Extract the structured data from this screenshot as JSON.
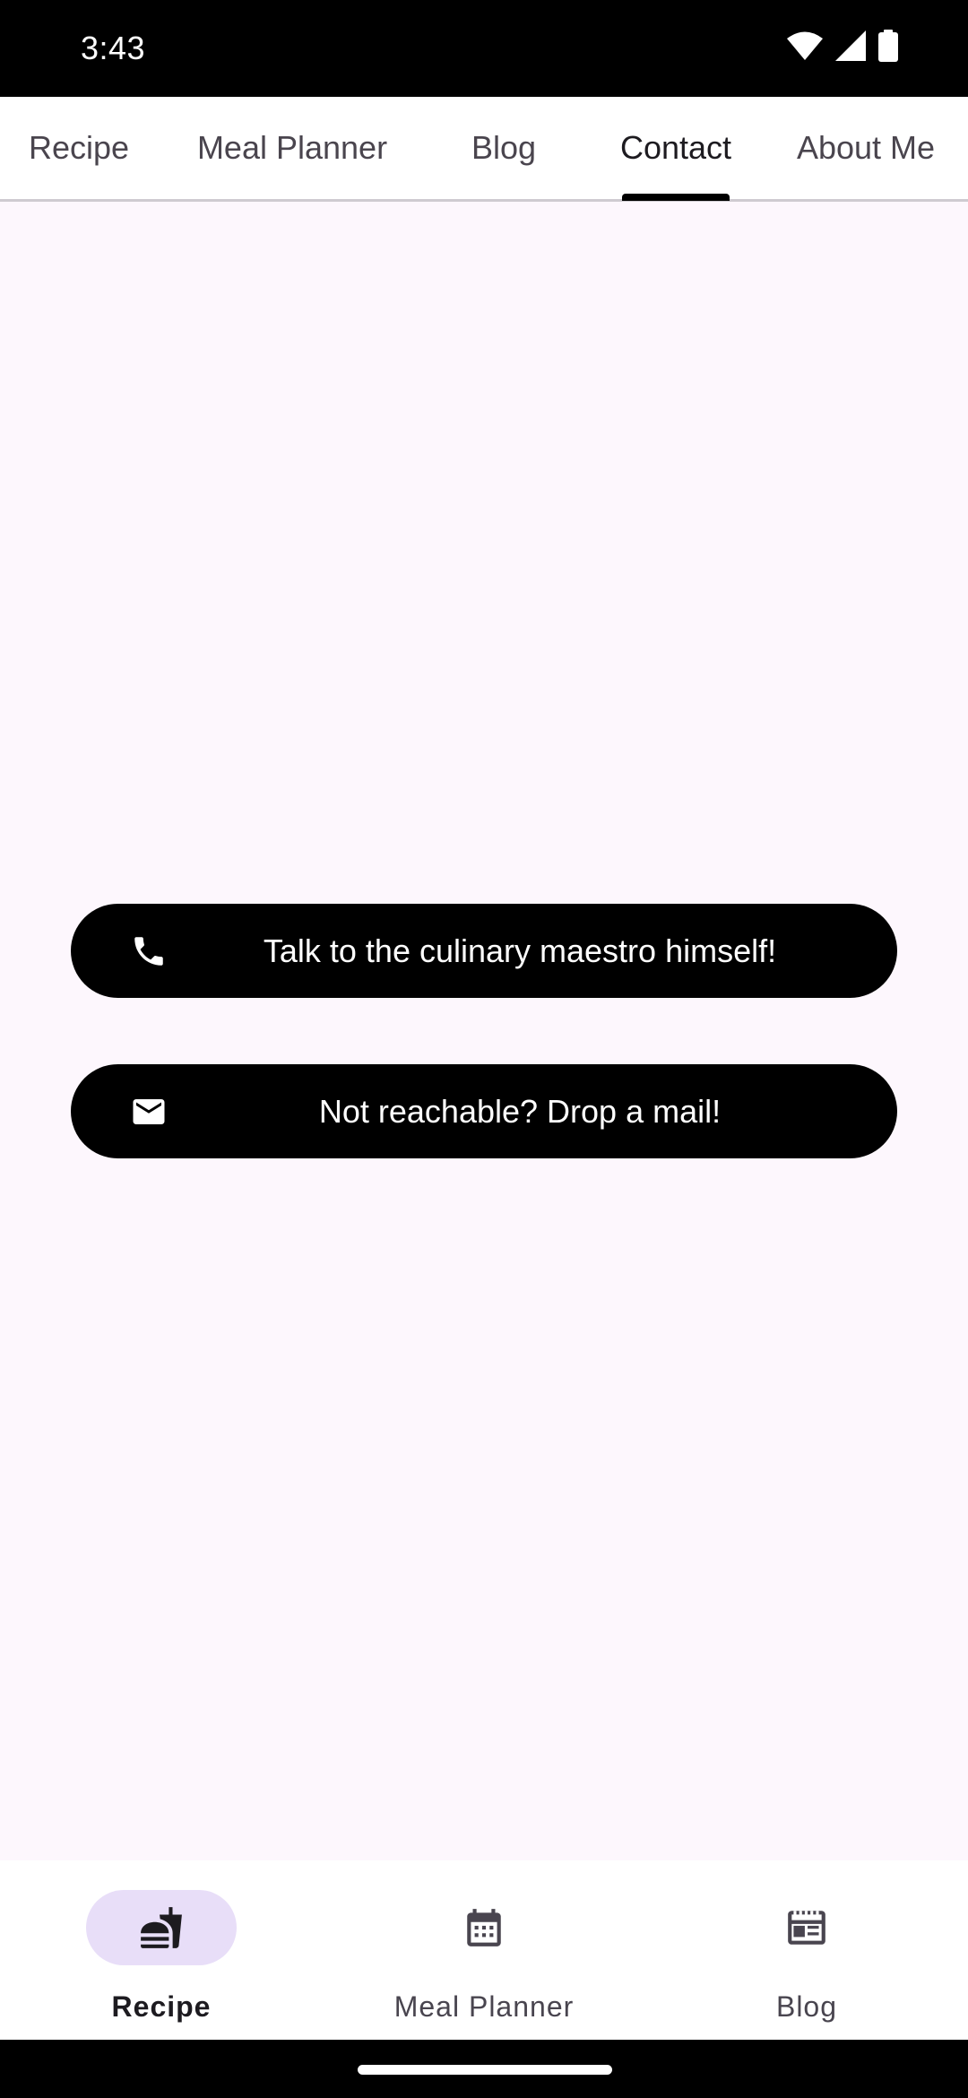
{
  "status_bar": {
    "time": "3:43",
    "icons": [
      "wifi-icon",
      "signal-icon",
      "battery-icon"
    ]
  },
  "top_tabs": {
    "selected": "Contact",
    "items": [
      {
        "label": "Recipe"
      },
      {
        "label": "Meal Planner"
      },
      {
        "label": "Blog"
      },
      {
        "label": "Contact"
      },
      {
        "label": "About Me"
      }
    ]
  },
  "contact": {
    "call_button": {
      "label": "Talk to the culinary maestro himself!",
      "icon": "phone-icon"
    },
    "mail_button": {
      "label": "Not reachable? Drop a mail!",
      "icon": "mail-icon"
    }
  },
  "bottom_nav": {
    "selected": "Recipe",
    "items": [
      {
        "label": "Recipe",
        "icon": "fastfood-icon"
      },
      {
        "label": "Meal Planner",
        "icon": "calendar-icon"
      },
      {
        "label": "Blog",
        "icon": "newspaper-icon"
      }
    ]
  },
  "colors": {
    "background": "#fdf7fd",
    "button": "#000000",
    "active_indicator": "#e8def8",
    "tab_text": "#4a454e"
  }
}
